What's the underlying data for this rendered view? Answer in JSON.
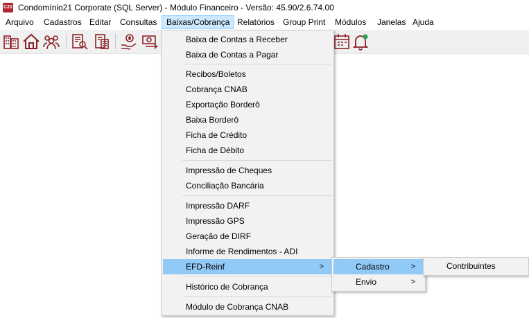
{
  "window": {
    "app_icon_text": "C21",
    "title": "Condomínio21 Corporate  (SQL Server)  - Módulo Financeiro - Versão: 45.90/2.6.74.00"
  },
  "menubar": {
    "items": [
      "Arquivo",
      "Cadastros",
      "Editar",
      "Consultas",
      "Baixas/Cobrança",
      "Relatórios",
      "Group Print",
      "Módulos",
      "Janelas",
      "Ajuda"
    ],
    "active": "Baixas/Cobrança"
  },
  "toolbar": {
    "icons": [
      "building-icon",
      "home-icon",
      "people-icon",
      "document-search-icon",
      "calculator-document-icon",
      "money-hand-icon",
      "cash-exchange-icon",
      "calendar-icon",
      "bell-icon"
    ]
  },
  "dropdown": {
    "items": [
      "Baixa de Contas a Receber",
      "Baixa de Contas a Pagar",
      "Recibos/Boletos",
      "Cobrança CNAB",
      "Exportação Borderô",
      "Baixa Borderô",
      "Ficha de Crédito",
      "Ficha de Débito",
      "Impressão de Cheques",
      "Conciliação Bancária",
      "Impressão DARF",
      "Impressão GPS",
      "Geração de DIRF",
      "Informe de Rendimentos - ADI",
      "EFD-Reinf",
      "Histórico de Cobrança",
      "Módulo de Cobrança CNAB"
    ],
    "highlighted": "EFD-Reinf",
    "submenu_arrow": ">"
  },
  "submenu_efd": {
    "items": [
      "Cadastro",
      "Envio"
    ],
    "highlighted": "Cadastro"
  },
  "submenu_cadastro": {
    "items": [
      "Contribuintes"
    ]
  },
  "colors": {
    "brand": "#b3262d",
    "menu_highlight": "#91c9f7",
    "menubar_active": "#cce8ff"
  }
}
